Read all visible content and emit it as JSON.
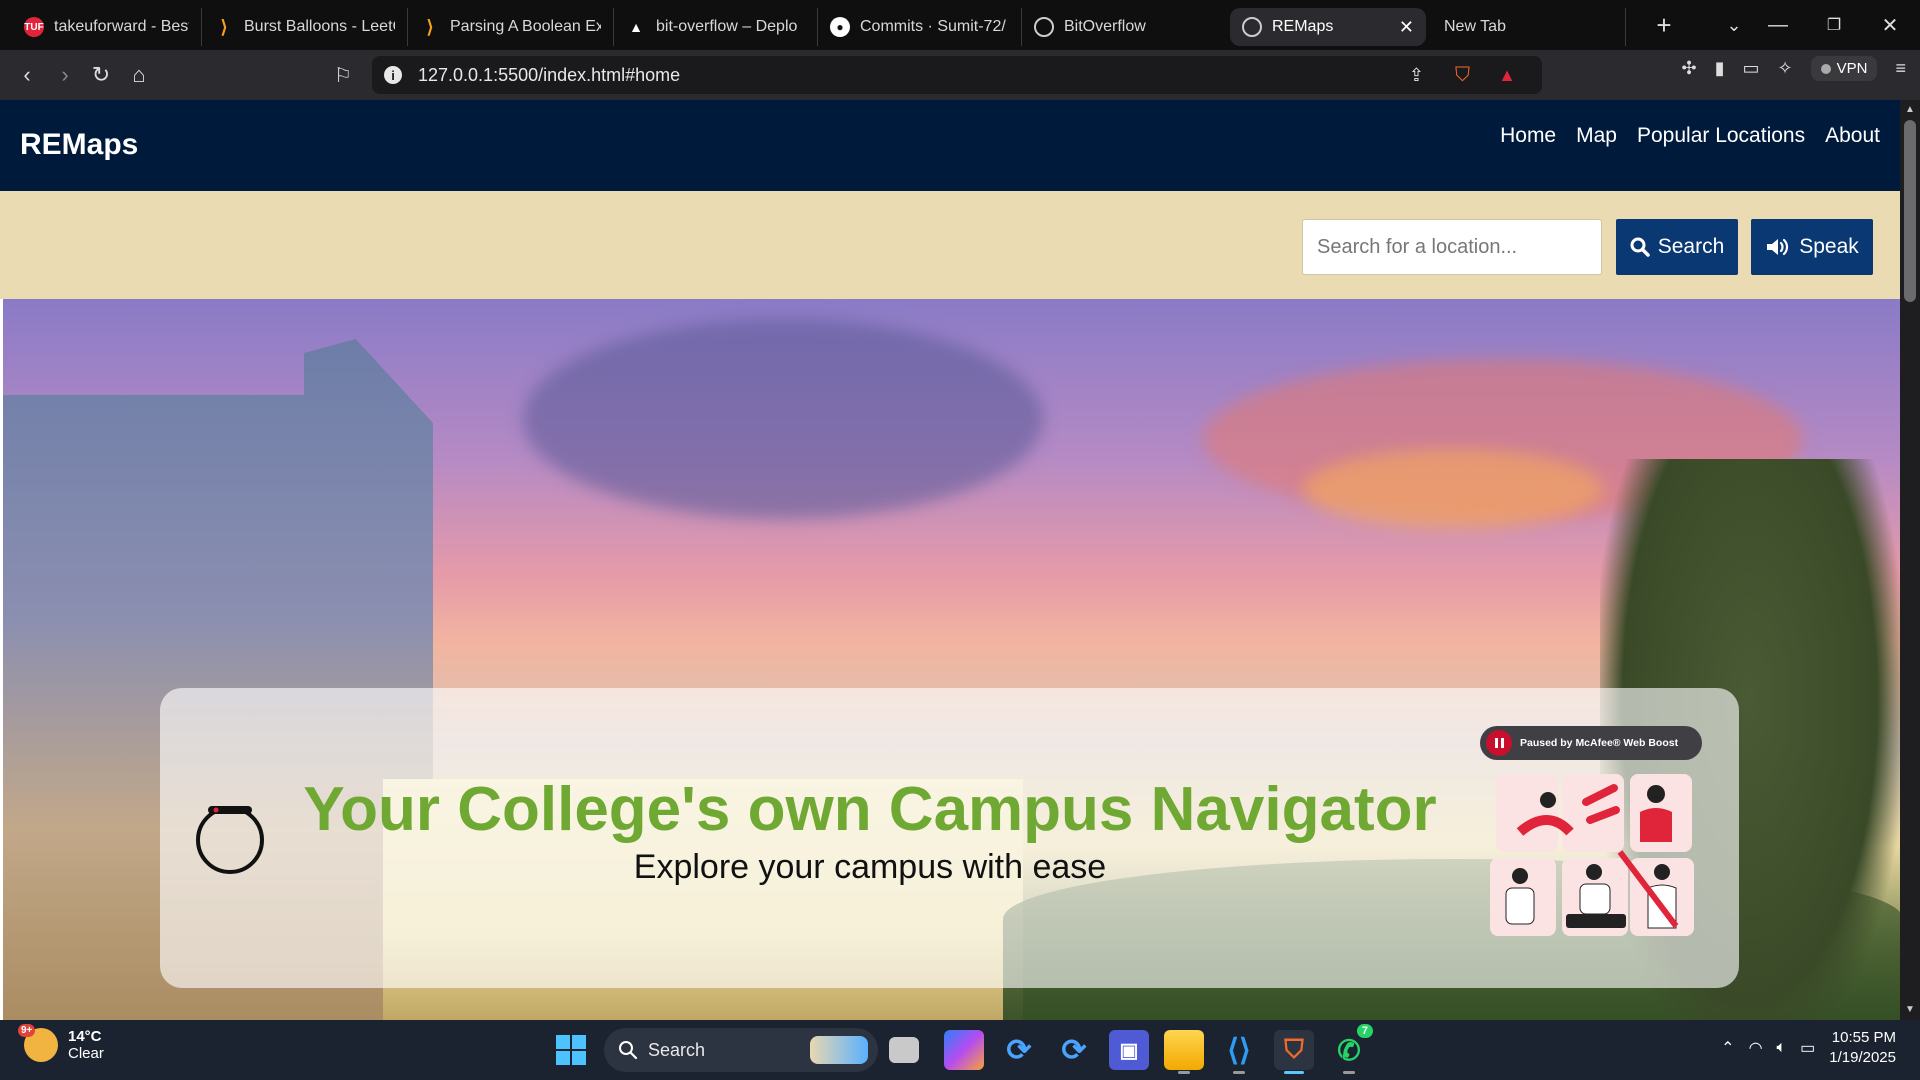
{
  "browser": {
    "tabs": [
      {
        "label": "takeuforward - Best C",
        "icon": "tuf-icon",
        "color": "#e0243a"
      },
      {
        "label": "Burst Balloons - LeetC",
        "icon": "leetcode-icon",
        "color": "#f89f1b"
      },
      {
        "label": "Parsing A Boolean Ex",
        "icon": "leetcode-icon",
        "color": "#f89f1b"
      },
      {
        "label": "bit-overflow – Deplo",
        "icon": "vercel-icon",
        "color": "#ffffff"
      },
      {
        "label": "Commits · Sumit-72/",
        "icon": "github-icon",
        "color": "#ffffff"
      },
      {
        "label": "BitOverflow",
        "icon": "globe-icon",
        "color": "#cccccc"
      },
      {
        "label": "REMaps",
        "icon": "globe-icon",
        "color": "#cccccc",
        "active": true
      },
      {
        "label": "New Tab",
        "icon": "",
        "color": ""
      }
    ],
    "url": "127.0.0.1:5500/index.html#home",
    "vpn_label": "VPN"
  },
  "site": {
    "brand": "REMaps",
    "nav": [
      "Home",
      "Map",
      "Popular Locations",
      "About"
    ],
    "search_placeholder": "Search for a location...",
    "search_button": "Search",
    "speak_button": "Speak",
    "hero_title": "Your College's own Campus Navigator",
    "hero_subtitle": "Explore your campus with ease",
    "mcafee_badge": "Paused by McAfee® Web Boost",
    "colors": {
      "navbar": "#001a3c",
      "searchbar": "#eadbb2",
      "button": "#0a3872",
      "title": "#6fa832"
    }
  },
  "taskbar": {
    "weather_badge": "9+",
    "temperature": "14°C",
    "condition": "Clear",
    "search_label": "Search",
    "whatsapp_badge": "7",
    "time": "10:55 PM",
    "date": "1/19/2025"
  }
}
